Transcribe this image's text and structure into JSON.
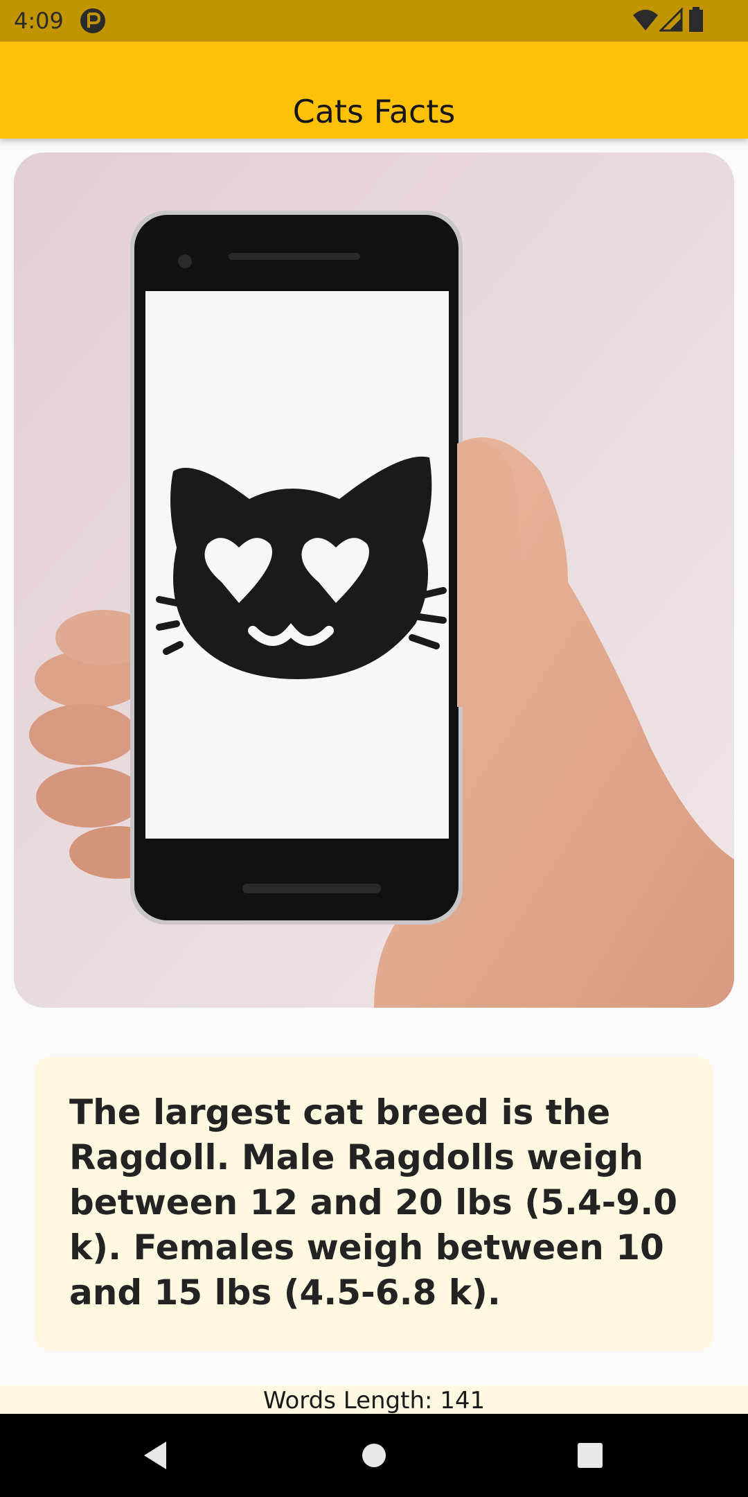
{
  "status_bar": {
    "time": "4:09",
    "icons": [
      "app-notification-icon",
      "wifi-icon",
      "signal-icon",
      "battery-icon"
    ]
  },
  "app_bar": {
    "title": "Cats Facts",
    "color": "#ffc107"
  },
  "hero_image": {
    "description_icon": "hand-holding-phone-with-cat-emoji-image"
  },
  "fact": {
    "text": "The largest cat breed is the Ragdoll. Male Ragdolls weigh between 12 and 20 lbs (5.4-9.0 k). Females weigh between 10 and 15 lbs (4.5-6.8 k)."
  },
  "footer": {
    "words_length": "Words Length: 141"
  },
  "nav_bar": {
    "buttons": [
      "back-icon",
      "home-icon",
      "recents-icon"
    ]
  }
}
